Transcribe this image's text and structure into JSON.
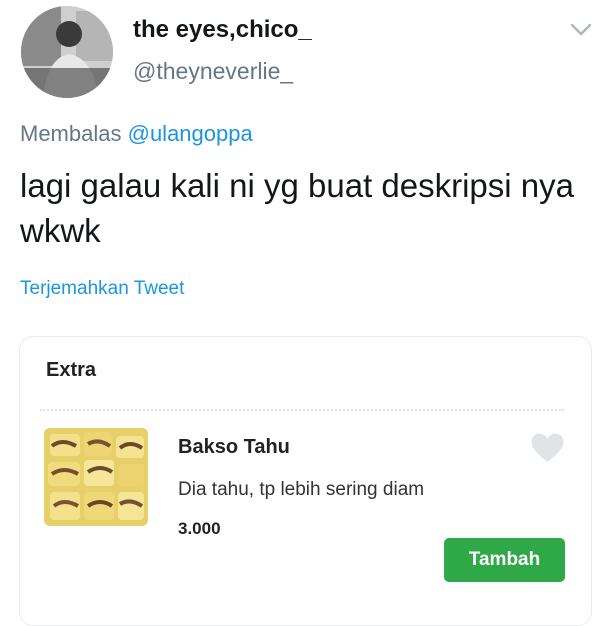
{
  "tweet": {
    "display_name": "the eyes,chico_",
    "handle": "@theyneverlie_",
    "reply_prefix": "Membalas",
    "reply_mention": "@ulangoppa",
    "text": "lagi galau kali ni yg buat deskripsi nya wkwk",
    "translate_label": "Terjemahkan Tweet",
    "icons": {
      "more": "chevron-down-icon"
    }
  },
  "card": {
    "section_title": "Extra",
    "item": {
      "name": "Bakso Tahu",
      "description": "Dia tahu, tp lebih sering diam",
      "price": "3.000",
      "add_button_label": "Tambah",
      "favorite_icon": "heart-icon"
    }
  },
  "colors": {
    "link": "#1b95e0",
    "secondary_text": "#657786",
    "button_green": "#2fa847",
    "heart_gray": "#e1e4e6"
  }
}
